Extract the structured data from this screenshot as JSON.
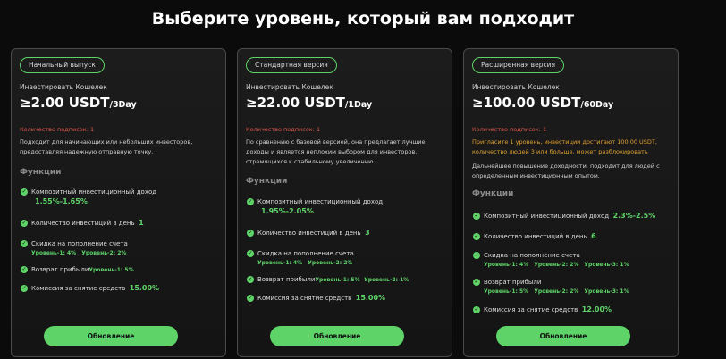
{
  "title": "Выберите уровень, который вам подходит",
  "cards": [
    {
      "badge": "Начальный выпуск",
      "invest_label": "Инвестировать Кошелек",
      "amount": "≥2.00 USDT",
      "period": "/3Day",
      "subscribers": "Количество подписок: 1",
      "description": "Подходит для начинающих или небольших инвесторов, предоставляя надежную отправную точку.",
      "features_title": "Функции",
      "features": {
        "composite_label": "Композитный инвестиционный доход",
        "composite_value": "1.55%-1.65%",
        "count_label": "Количество инвестиций в день",
        "count_value": "1",
        "discount_label": "Скидка на пополнение счета",
        "discount_levels": [
          "Уровень-1: 4%",
          "Уровень-2: 2%"
        ],
        "refund_label": "Возврат прибыли",
        "refund_levels": [
          "Уровень-1: 5%"
        ],
        "fee_label": "Комиссия за снятие средств",
        "fee_value": "15.00%"
      },
      "button": "Обновление"
    },
    {
      "badge": "Стандартная версия",
      "invest_label": "Инвестировать Кошелек",
      "amount": "≥22.00 USDT",
      "period": "/1Day",
      "subscribers": "Количество подписок: 1",
      "description": "По сравнению с базовой версией, она предлагает лучшие доходы и является неплохим выбором для инвесторов, стремящихся к стабильному увеличению.",
      "features_title": "Функции",
      "features": {
        "composite_label": "Композитный инвестиционный доход",
        "composite_value": "1.95%-2.05%",
        "count_label": "Количество инвестиций в день",
        "count_value": "3",
        "discount_label": "Скидка на пополнение счета",
        "discount_levels": [
          "Уровень-1: 4%",
          "Уровень-2: 2%"
        ],
        "refund_label": "Возврат прибыли",
        "refund_levels": [
          "Уровень-1: 5%",
          "Уровень-2: 1%"
        ],
        "fee_label": "Комиссия за снятие средств",
        "fee_value": "15.00%"
      },
      "button": "Обновление"
    },
    {
      "badge": "Расширенная версия",
      "invest_label": "Инвестировать Кошелек",
      "amount": "≥100.00 USDT",
      "period": "/60Day",
      "subscribers": "Количество подписок: 1",
      "invite_note": "Пригласите 1 уровень, инвестиции достигают 100.00 USDT, количество людей 3 или больше, может разблокировать",
      "description": "Дальнейшее повышение доходности, подходит для людей с определенным инвестиционным опытом.",
      "features_title": "Функции",
      "features": {
        "composite_label": "Композитный инвестиционный доход",
        "composite_value": "2.3%-2.5%",
        "count_label": "Количество инвестиций в день",
        "count_value": "6",
        "discount_label": "Скидка на пополнение счета",
        "discount_levels": [
          "Уровень-1: 4%",
          "Уровень-2: 2%",
          "Уровень-3: 1%"
        ],
        "refund_label": "Возврат прибыли",
        "refund_levels": [
          "Уровень-1: 5%",
          "Уровень-2: 2%",
          "Уровень-3: 1%"
        ],
        "fee_label": "Комиссия за снятие средств",
        "fee_value": "12.00%"
      },
      "button": "Обновление"
    }
  ],
  "colors": {
    "accent": "#5ed468",
    "warning": "#e05a4a",
    "note": "#e0a030"
  },
  "icons": {
    "feature_check": "check-circle-icon"
  }
}
